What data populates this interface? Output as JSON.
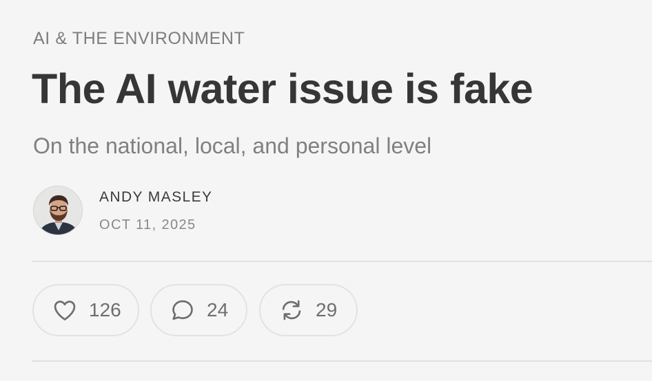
{
  "post": {
    "section": "AI & THE ENVIRONMENT",
    "title": "The AI water issue is fake",
    "subtitle": "On the national, local, and personal level",
    "author": "ANDY MASLEY",
    "date": "OCT 11, 2025"
  },
  "actions": {
    "like": {
      "icon": "heart-icon",
      "count": "126"
    },
    "comment": {
      "icon": "speech-bubble-icon",
      "count": "24"
    },
    "restack": {
      "icon": "restack-arrows-icon",
      "count": "29"
    }
  },
  "colors": {
    "background": "#f5f5f5",
    "title": "#363636",
    "muted": "#808080",
    "border": "#e2e2e2"
  }
}
